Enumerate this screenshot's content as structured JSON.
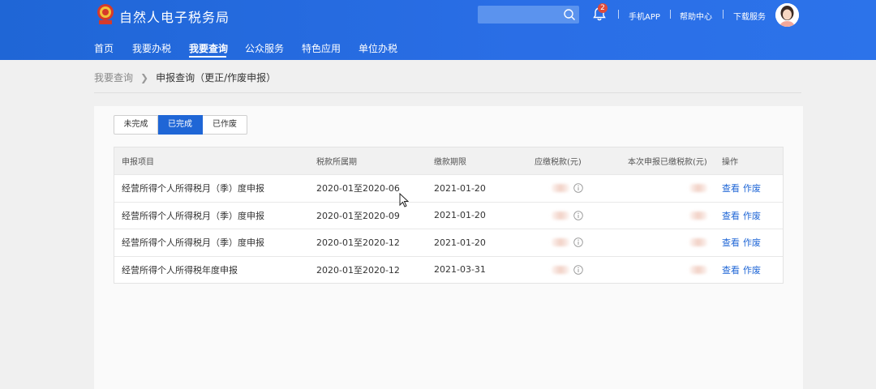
{
  "header": {
    "site_title": "自然人电子税务局",
    "search": {
      "placeholder": "",
      "icon": "search-icon"
    },
    "notification_count": "2",
    "links": [
      "手机APP",
      "帮助中心",
      "下载服务"
    ],
    "colors": {
      "primary": "#1f66d6",
      "badge": "#e04a3b"
    }
  },
  "nav": {
    "items": [
      {
        "label": "首页"
      },
      {
        "label": "我要办税"
      },
      {
        "label": "我要查询"
      },
      {
        "label": "公众服务"
      },
      {
        "label": "特色应用"
      },
      {
        "label": "单位办税"
      }
    ],
    "active": "我要查询"
  },
  "breadcrumb": {
    "parent": "我要查询",
    "current": "申报查询（更正/作废申报）"
  },
  "tabs": [
    {
      "label": "未完成"
    },
    {
      "label": "已完成"
    },
    {
      "label": "已作废"
    }
  ],
  "active_tab": "已完成",
  "table": {
    "headers": [
      "申报项目",
      "税款所属期",
      "缴款期限",
      "应缴税款(元)",
      "本次申报已缴税款(元)",
      "操作"
    ],
    "rows": [
      {
        "item": "经营所得个人所得税月（季）度申报",
        "period": "2020-01至2020-06",
        "deadline": "2021-01-20",
        "actions": [
          "查看",
          "作废"
        ]
      },
      {
        "item": "经营所得个人所得税月（季）度申报",
        "period": "2020-01至2020-09",
        "deadline": "2021-01-20",
        "actions": [
          "查看",
          "作废"
        ]
      },
      {
        "item": "经营所得个人所得税月（季）度申报",
        "period": "2020-01至2020-12",
        "deadline": "2021-01-20",
        "actions": [
          "查看",
          "作废"
        ]
      },
      {
        "item": "经营所得个人所得税年度申报",
        "period": "2020-01至2020-12",
        "deadline": "2021-03-31",
        "actions": [
          "查看",
          "作废"
        ]
      }
    ]
  }
}
